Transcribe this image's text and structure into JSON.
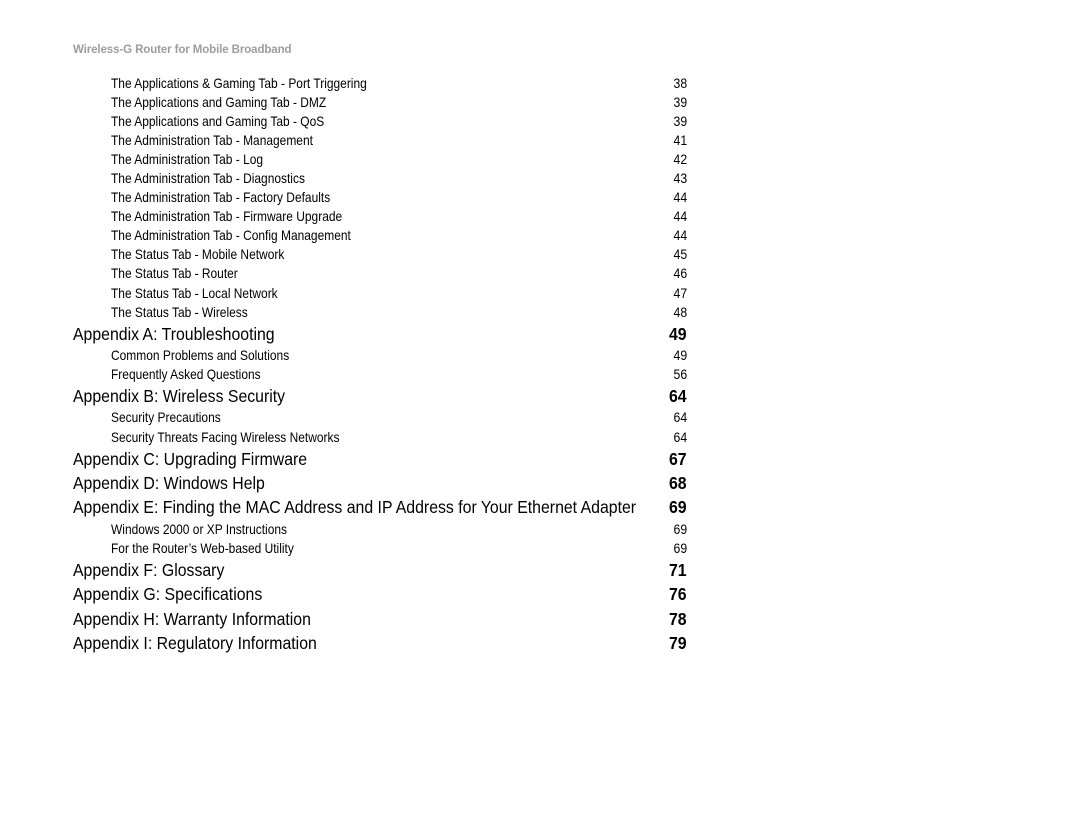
{
  "document": {
    "running_header": "Wireless-G Router for Mobile Broadband"
  },
  "toc": {
    "entries": [
      {
        "level": "sub",
        "title": "The Applications & Gaming Tab - Port Triggering",
        "page": "38"
      },
      {
        "level": "sub",
        "title": "The Applications and Gaming Tab - DMZ",
        "page": "39"
      },
      {
        "level": "sub",
        "title": "The Applications and Gaming Tab - QoS",
        "page": "39"
      },
      {
        "level": "sub",
        "title": "The Administration Tab - Management",
        "page": "41"
      },
      {
        "level": "sub",
        "title": "The Administration Tab - Log",
        "page": "42"
      },
      {
        "level": "sub",
        "title": "The Administration Tab - Diagnostics",
        "page": "43"
      },
      {
        "level": "sub",
        "title": "The Administration Tab - Factory Defaults",
        "page": "44"
      },
      {
        "level": "sub",
        "title": "The Administration Tab - Firmware Upgrade",
        "page": "44"
      },
      {
        "level": "sub",
        "title": "The Administration Tab - Config Management",
        "page": "44"
      },
      {
        "level": "sub",
        "title": "The Status Tab - Mobile Network",
        "page": "45"
      },
      {
        "level": "sub",
        "title": "The Status Tab - Router",
        "page": "46"
      },
      {
        "level": "sub",
        "title": "The Status Tab - Local Network",
        "page": "47"
      },
      {
        "level": "sub",
        "title": "The Status Tab - Wireless",
        "page": "48"
      },
      {
        "level": "head",
        "title": "Appendix A: Troubleshooting",
        "page": "49"
      },
      {
        "level": "sub",
        "title": "Common Problems and Solutions",
        "page": "49"
      },
      {
        "level": "sub",
        "title": "Frequently Asked Questions",
        "page": "56"
      },
      {
        "level": "head",
        "title": "Appendix B: Wireless Security",
        "page": "64"
      },
      {
        "level": "sub",
        "title": "Security Precautions",
        "page": "64"
      },
      {
        "level": "sub",
        "title": "Security Threats Facing Wireless Networks",
        "page": "64"
      },
      {
        "level": "head",
        "title": "Appendix C: Upgrading Firmware",
        "page": "67"
      },
      {
        "level": "head",
        "title": "Appendix D: Windows Help",
        "page": "68"
      },
      {
        "level": "head",
        "title": "Appendix E: Finding the MAC Address and IP Address for Your Ethernet Adapter",
        "page": "69"
      },
      {
        "level": "sub",
        "title": "Windows 2000 or XP Instructions",
        "page": "69"
      },
      {
        "level": "sub",
        "title": "For the Router’s Web-based Utility",
        "page": "69"
      },
      {
        "level": "head",
        "title": "Appendix F: Glossary",
        "page": "71"
      },
      {
        "level": "head",
        "title": "Appendix G: Specifications",
        "page": "76"
      },
      {
        "level": "head",
        "title": "Appendix H: Warranty Information",
        "page": "78"
      },
      {
        "level": "head",
        "title": "Appendix I: Regulatory Information",
        "page": "79"
      }
    ]
  }
}
